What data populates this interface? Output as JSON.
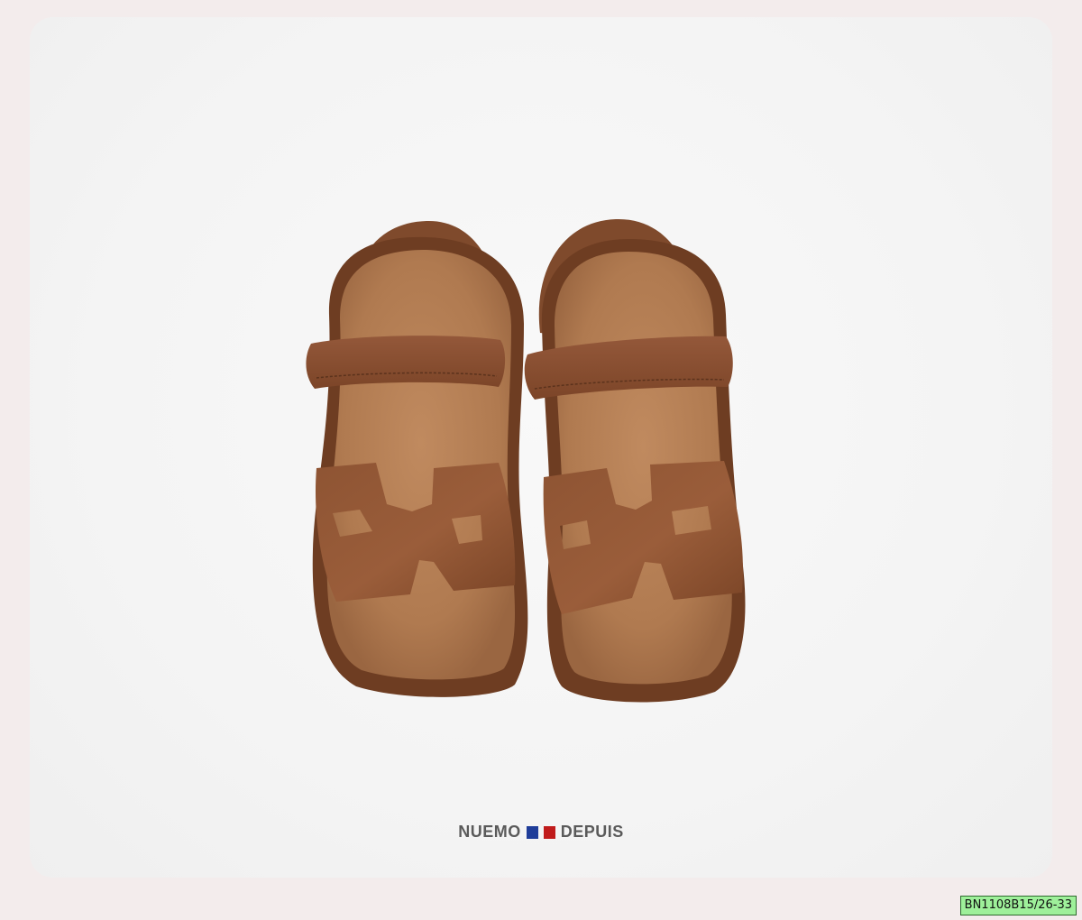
{
  "brand": {
    "left_text": "NUEMO",
    "right_text": "DEPUIS",
    "flag_colors": [
      "#1f3d99",
      "#c01b1b"
    ]
  },
  "sku_label": "BN1108B15/26-33",
  "colors": {
    "page_background": "#f3ecec",
    "card_background": "#f6f6f6",
    "leather": "#8a5130",
    "footbed": "#b88258",
    "sku_tag_background": "#9ef09a"
  }
}
